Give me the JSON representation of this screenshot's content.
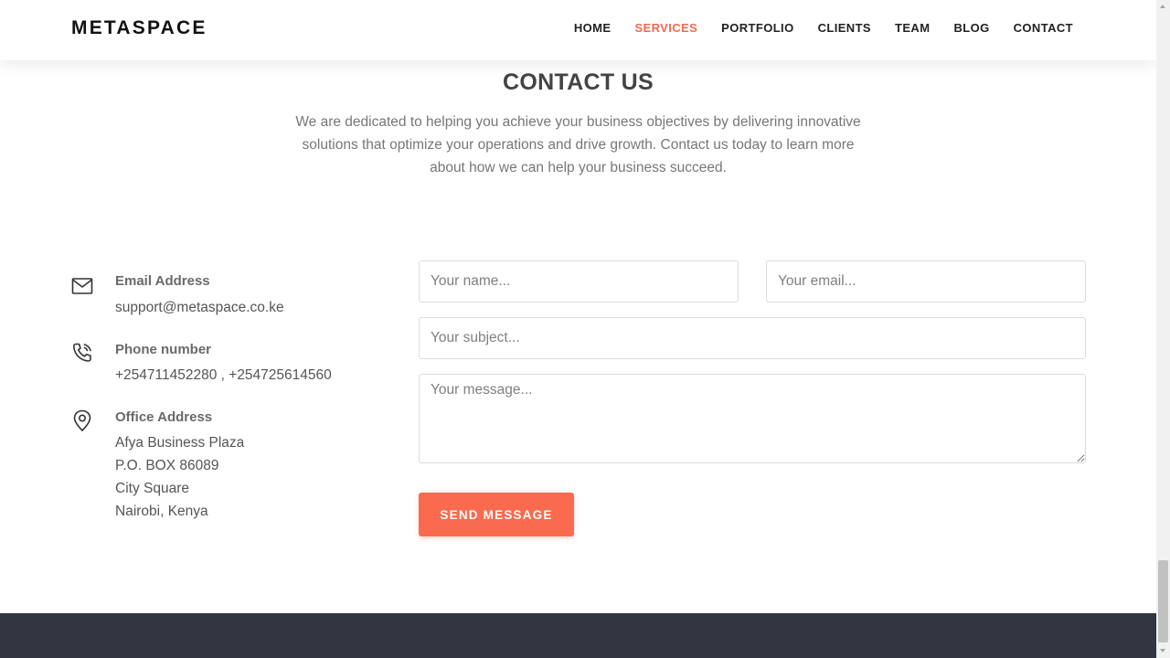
{
  "brand": {
    "name": "METASPACE"
  },
  "nav": {
    "items": [
      {
        "label": "HOME"
      },
      {
        "label": "SERVICES",
        "active": true
      },
      {
        "label": "PORTFOLIO"
      },
      {
        "label": "CLIENTS"
      },
      {
        "label": "TEAM"
      },
      {
        "label": "BLOG"
      },
      {
        "label": "CONTACT"
      }
    ]
  },
  "section": {
    "title": "CONTACT US",
    "subtitle": "We are dedicated to helping you achieve your business objectives by delivering innovative solutions that optimize your operations and drive growth. Contact us today to learn more about how we can help your business succeed."
  },
  "contact": {
    "email": {
      "title": "Email Address",
      "value": "support@metaspace.co.ke",
      "icon": "envelope-icon"
    },
    "phone": {
      "title": "Phone number",
      "value": "+254711452280 , +254725614560",
      "icon": "phone-icon"
    },
    "office": {
      "title": "Office Address",
      "icon": "map-pin-icon",
      "lines": [
        "Afya Business Plaza",
        "P.O. BOX 86089",
        "City Square",
        "Nairobi, Kenya"
      ]
    }
  },
  "form": {
    "name_placeholder": "Your name...",
    "email_placeholder": "Your email...",
    "subject_placeholder": "Your subject...",
    "message_placeholder": "Your message...",
    "submit_label": "SEND MESSAGE"
  },
  "colors": {
    "accent": "#f96a4f",
    "footer": "#333640"
  }
}
